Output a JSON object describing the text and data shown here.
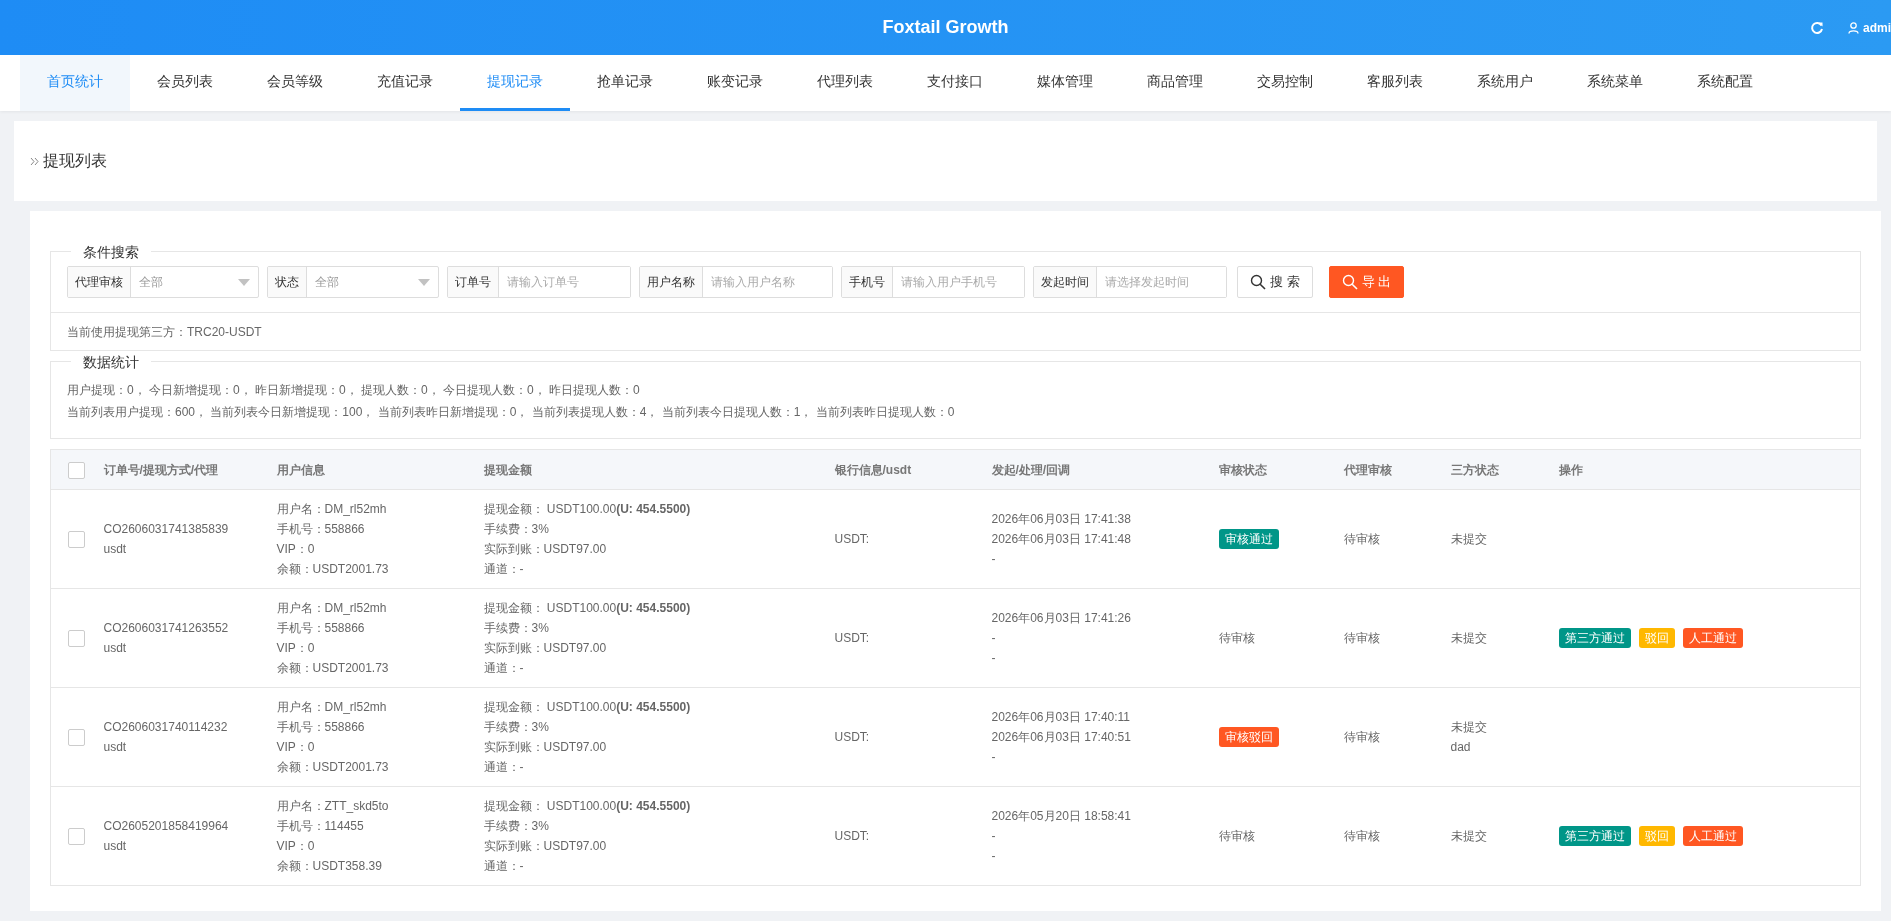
{
  "header": {
    "title": "Foxtail Growth",
    "user": "admi"
  },
  "nav": [
    {
      "label": "首页统计",
      "selected": false,
      "highlighted": true
    },
    {
      "label": "会员列表",
      "selected": false,
      "highlighted": false
    },
    {
      "label": "会员等级",
      "selected": false,
      "highlighted": false
    },
    {
      "label": "充值记录",
      "selected": false,
      "highlighted": false
    },
    {
      "label": "提现记录",
      "selected": true,
      "highlighted": false
    },
    {
      "label": "抢单记录",
      "selected": false,
      "highlighted": false
    },
    {
      "label": "账变记录",
      "selected": false,
      "highlighted": false
    },
    {
      "label": "代理列表",
      "selected": false,
      "highlighted": false
    },
    {
      "label": "支付接口",
      "selected": false,
      "highlighted": false
    },
    {
      "label": "媒体管理",
      "selected": false,
      "highlighted": false
    },
    {
      "label": "商品管理",
      "selected": false,
      "highlighted": false
    },
    {
      "label": "交易控制",
      "selected": false,
      "highlighted": false
    },
    {
      "label": "客服列表",
      "selected": false,
      "highlighted": false
    },
    {
      "label": "系统用户",
      "selected": false,
      "highlighted": false
    },
    {
      "label": "系统菜单",
      "selected": false,
      "highlighted": false
    },
    {
      "label": "系统配置",
      "selected": false,
      "highlighted": false
    }
  ],
  "page_title": "提现列表",
  "search": {
    "legend": "条件搜索",
    "filters": [
      {
        "kind": "select",
        "label": "代理审核",
        "value": "全部"
      },
      {
        "kind": "select",
        "label": "状态",
        "value": "全部"
      },
      {
        "kind": "input",
        "label": "订单号",
        "placeholder": "请输入订单号"
      },
      {
        "kind": "input",
        "label": "用户名称",
        "placeholder": "请输入用户名称"
      },
      {
        "kind": "input",
        "label": "手机号",
        "placeholder": "请输入用户手机号"
      },
      {
        "kind": "input",
        "label": "发起时间",
        "placeholder": "请选择发起时间"
      }
    ],
    "buttons": [
      {
        "kind": "default",
        "label": "搜 索"
      },
      {
        "kind": "danger",
        "label": "导 出"
      }
    ]
  },
  "provider_note": "当前使用提现第三方：TRC20-USDT",
  "stats": {
    "legend": "数据统计",
    "lines": [
      "用户提现：0， 今日新增提现：0， 昨日新增提现：0， 提现人数：0， 今日提现人数：0， 昨日提现人数：0",
      "当前列表用户提现：600， 当前列表今日新增提现：100， 当前列表昨日新增提现：0， 当前列表提现人数：4， 当前列表今日提现人数：1， 当前列表昨日提现人数：0"
    ]
  },
  "table": {
    "header_checked": false,
    "columns": [
      "订单号/提现方式/代理",
      "用户信息",
      "提现金额",
      "银行信息/usdt",
      "发起/处理/回调",
      "审核状态",
      "代理审核",
      "三方状态",
      "操作"
    ],
    "rows": [
      {
        "checked": false,
        "order": [
          "CO2606031741385839",
          "usdt"
        ],
        "user": [
          "用户名：DM_rl52mh",
          "手机号：558866",
          "VIP：0",
          "余额：USDT2001.73"
        ],
        "amount": [
          "提现金额： USDT100.00**(U: 454.5500)**",
          "手续费：3%",
          "实际到账：USDT97.00",
          "通道：-"
        ],
        "bank": "USDT:",
        "times": [
          "2026年06月03日 17:41:38",
          "2026年06月03日 17:41:48",
          "-"
        ],
        "audit": {
          "kind": "approved",
          "text": "审核通过"
        },
        "agent": "待审核",
        "third": [
          "未提交"
        ],
        "actions": []
      },
      {
        "checked": false,
        "order": [
          "CO2606031741263552",
          "usdt"
        ],
        "user": [
          "用户名：DM_rl52mh",
          "手机号：558866",
          "VIP：0",
          "余额：USDT2001.73"
        ],
        "amount": [
          "提现金额： USDT100.00**(U: 454.5500)**",
          "手续费：3%",
          "实际到账：USDT97.00",
          "通道：-"
        ],
        "bank": "USDT:",
        "times": [
          "2026年06月03日 17:41:26",
          "-",
          "-"
        ],
        "audit": {
          "kind": "plain",
          "text": "待审核"
        },
        "agent": "待审核",
        "third": [
          "未提交"
        ],
        "actions": [
          {
            "kind": "success",
            "label": "第三方通过"
          },
          {
            "kind": "warning",
            "label": "驳回"
          },
          {
            "kind": "danger",
            "label": "人工通过"
          }
        ]
      },
      {
        "checked": false,
        "order": [
          "CO2606031740114232",
          "usdt"
        ],
        "user": [
          "用户名：DM_rl52mh",
          "手机号：558866",
          "VIP：0",
          "余额：USDT2001.73"
        ],
        "amount": [
          "提现金额： USDT100.00**(U: 454.5500)**",
          "手续费：3%",
          "实际到账：USDT97.00",
          "通道：-"
        ],
        "bank": "USDT:",
        "times": [
          "2026年06月03日 17:40:11",
          "2026年06月03日 17:40:51",
          "-"
        ],
        "audit": {
          "kind": "rejected",
          "text": "审核驳回"
        },
        "agent": "待审核",
        "third": [
          "未提交",
          "dad"
        ],
        "actions": []
      },
      {
        "checked": false,
        "order": [
          "CO2605201858419964",
          "usdt"
        ],
        "user": [
          "用户名：ZTT_skd5to",
          "手机号：114455",
          "VIP：0",
          "余额：USDT358.39"
        ],
        "amount": [
          "提现金额： USDT100.00**(U: 454.5500)**",
          "手续费：3%",
          "实际到账：USDT97.00",
          "通道：-"
        ],
        "bank": "USDT:",
        "times": [
          "2026年05月20日 18:58:41",
          "-",
          "-"
        ],
        "audit": {
          "kind": "plain",
          "text": "待审核"
        },
        "agent": "待审核",
        "third": [
          "未提交"
        ],
        "actions": [
          {
            "kind": "success",
            "label": "第三方通过"
          },
          {
            "kind": "warning",
            "label": "驳回"
          },
          {
            "kind": "danger",
            "label": "人工通过"
          }
        ]
      }
    ]
  }
}
